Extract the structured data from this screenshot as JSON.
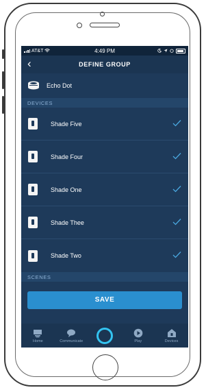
{
  "status_bar": {
    "carrier": "AT&T",
    "time": "4:49 PM"
  },
  "header": {
    "title": "DEFINE GROUP"
  },
  "group_device": {
    "name": "Echo Dot"
  },
  "sections": {
    "devices": "DEVICES",
    "scenes": "SCENES"
  },
  "devices": [
    {
      "name": "Shade Five",
      "checked": true
    },
    {
      "name": "Shade Four",
      "checked": true
    },
    {
      "name": "Shade One",
      "checked": true
    },
    {
      "name": "Shade Thee",
      "checked": true
    },
    {
      "name": "Shade Two",
      "checked": true
    }
  ],
  "save_button": {
    "label": "SAVE"
  },
  "bottom_nav": [
    {
      "label": "Home",
      "icon": "home-icon"
    },
    {
      "label": "Communicate",
      "icon": "chat-bubble-icon"
    },
    {
      "label": "",
      "icon": "alexa-ring-icon"
    },
    {
      "label": "Play",
      "icon": "play-icon"
    },
    {
      "label": "Devices",
      "icon": "smart-home-icon"
    }
  ],
  "colors": {
    "background": "#1e3a5a",
    "accent": "#2a8fcf",
    "alexa": "#33c3f0"
  }
}
